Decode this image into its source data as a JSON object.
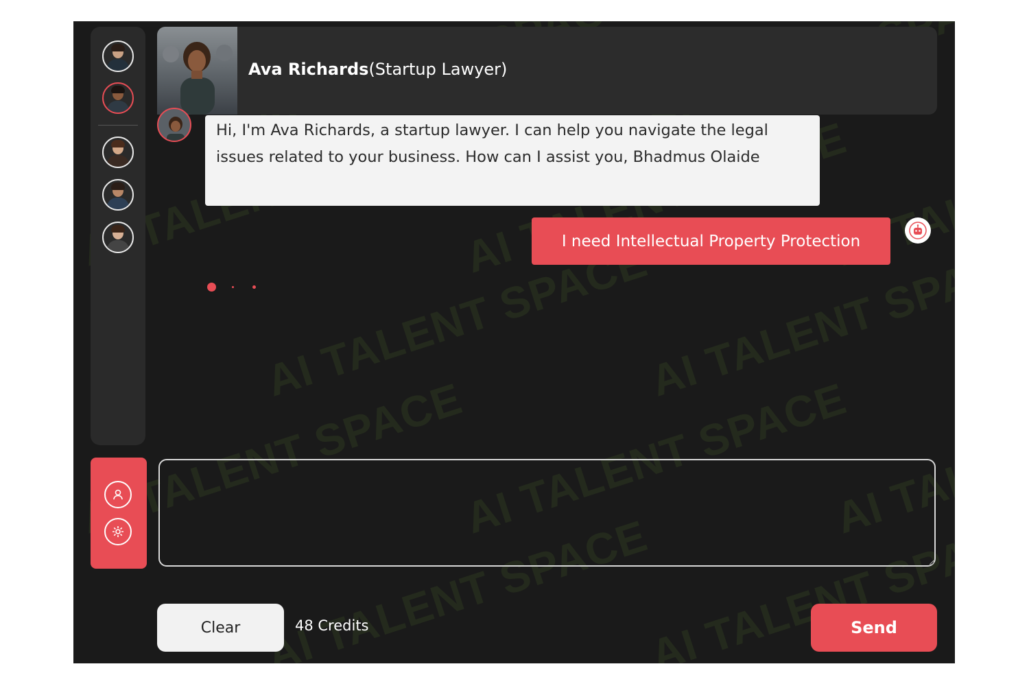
{
  "colors": {
    "accent": "#e84d55",
    "background": "#1a1a1a",
    "panel": "#2a2a2a"
  },
  "watermark": "AI TALENT SPACE",
  "sidebar": {
    "avatars": [
      {
        "name": "advisor-1",
        "active": false
      },
      {
        "name": "advisor-ava-richards",
        "active": true
      },
      {
        "name": "advisor-3",
        "active": false
      },
      {
        "name": "advisor-4",
        "active": false
      },
      {
        "name": "advisor-5",
        "active": false
      }
    ],
    "tools": [
      {
        "icon": "user-icon"
      },
      {
        "icon": "gear-icon"
      }
    ]
  },
  "header": {
    "name": "Ava Richards",
    "role": "(Startup Lawyer)"
  },
  "messages": [
    {
      "sender": "bot",
      "text": "Hi, I'm Ava Richards, a startup lawyer. I can help you navigate the legal issues related to your business. How can I assist you, Bhadmus Olaide"
    },
    {
      "sender": "user",
      "text": "I need Intellectual Property Protection"
    }
  ],
  "composer": {
    "value": "",
    "placeholder": ""
  },
  "footer": {
    "clear_label": "Clear",
    "credits": "48 Credits",
    "send_label": "Send"
  }
}
